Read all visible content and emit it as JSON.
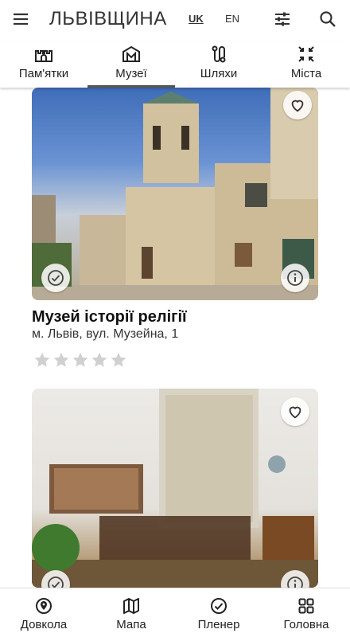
{
  "app": {
    "title": "ЛЬВІВЩИНА"
  },
  "languages": {
    "uk": "UK",
    "en": "EN"
  },
  "tabs": [
    {
      "label": "Пам'ятки",
      "icon": "castle-icon"
    },
    {
      "label": "Музеї",
      "icon": "museum-icon",
      "active": true
    },
    {
      "label": "Шляхи",
      "icon": "route-icon"
    },
    {
      "label": "Міста",
      "icon": "collapse-icon"
    }
  ],
  "cards": [
    {
      "title": "Музей історії релігії",
      "address": "м. Львів, вул. Музейна, 1",
      "rating": 0,
      "max_rating": 5
    }
  ],
  "bottom_nav": [
    {
      "label": "Довкола",
      "icon": "nearby-pin-icon"
    },
    {
      "label": "Мапа",
      "icon": "map-icon"
    },
    {
      "label": "Пленер",
      "icon": "check-circle-icon"
    },
    {
      "label": "Головна",
      "icon": "grid-icon"
    }
  ],
  "colors": {
    "icon": "#333333",
    "star_empty": "#d0d0d0",
    "active_tab_indicator": "#555555"
  }
}
